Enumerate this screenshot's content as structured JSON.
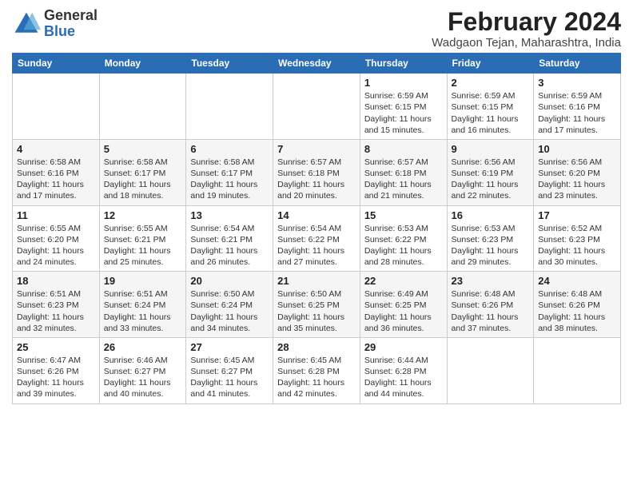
{
  "logo": {
    "general": "General",
    "blue": "Blue"
  },
  "header": {
    "month_year": "February 2024",
    "location": "Wadgaon Tejan, Maharashtra, India"
  },
  "weekdays": [
    "Sunday",
    "Monday",
    "Tuesday",
    "Wednesday",
    "Thursday",
    "Friday",
    "Saturday"
  ],
  "weeks": [
    [
      {
        "day": "",
        "info": ""
      },
      {
        "day": "",
        "info": ""
      },
      {
        "day": "",
        "info": ""
      },
      {
        "day": "",
        "info": ""
      },
      {
        "day": "1",
        "info": "Sunrise: 6:59 AM\nSunset: 6:15 PM\nDaylight: 11 hours\nand 15 minutes."
      },
      {
        "day": "2",
        "info": "Sunrise: 6:59 AM\nSunset: 6:15 PM\nDaylight: 11 hours\nand 16 minutes."
      },
      {
        "day": "3",
        "info": "Sunrise: 6:59 AM\nSunset: 6:16 PM\nDaylight: 11 hours\nand 17 minutes."
      }
    ],
    [
      {
        "day": "4",
        "info": "Sunrise: 6:58 AM\nSunset: 6:16 PM\nDaylight: 11 hours\nand 17 minutes."
      },
      {
        "day": "5",
        "info": "Sunrise: 6:58 AM\nSunset: 6:17 PM\nDaylight: 11 hours\nand 18 minutes."
      },
      {
        "day": "6",
        "info": "Sunrise: 6:58 AM\nSunset: 6:17 PM\nDaylight: 11 hours\nand 19 minutes."
      },
      {
        "day": "7",
        "info": "Sunrise: 6:57 AM\nSunset: 6:18 PM\nDaylight: 11 hours\nand 20 minutes."
      },
      {
        "day": "8",
        "info": "Sunrise: 6:57 AM\nSunset: 6:18 PM\nDaylight: 11 hours\nand 21 minutes."
      },
      {
        "day": "9",
        "info": "Sunrise: 6:56 AM\nSunset: 6:19 PM\nDaylight: 11 hours\nand 22 minutes."
      },
      {
        "day": "10",
        "info": "Sunrise: 6:56 AM\nSunset: 6:20 PM\nDaylight: 11 hours\nand 23 minutes."
      }
    ],
    [
      {
        "day": "11",
        "info": "Sunrise: 6:55 AM\nSunset: 6:20 PM\nDaylight: 11 hours\nand 24 minutes."
      },
      {
        "day": "12",
        "info": "Sunrise: 6:55 AM\nSunset: 6:21 PM\nDaylight: 11 hours\nand 25 minutes."
      },
      {
        "day": "13",
        "info": "Sunrise: 6:54 AM\nSunset: 6:21 PM\nDaylight: 11 hours\nand 26 minutes."
      },
      {
        "day": "14",
        "info": "Sunrise: 6:54 AM\nSunset: 6:22 PM\nDaylight: 11 hours\nand 27 minutes."
      },
      {
        "day": "15",
        "info": "Sunrise: 6:53 AM\nSunset: 6:22 PM\nDaylight: 11 hours\nand 28 minutes."
      },
      {
        "day": "16",
        "info": "Sunrise: 6:53 AM\nSunset: 6:23 PM\nDaylight: 11 hours\nand 29 minutes."
      },
      {
        "day": "17",
        "info": "Sunrise: 6:52 AM\nSunset: 6:23 PM\nDaylight: 11 hours\nand 30 minutes."
      }
    ],
    [
      {
        "day": "18",
        "info": "Sunrise: 6:51 AM\nSunset: 6:23 PM\nDaylight: 11 hours\nand 32 minutes."
      },
      {
        "day": "19",
        "info": "Sunrise: 6:51 AM\nSunset: 6:24 PM\nDaylight: 11 hours\nand 33 minutes."
      },
      {
        "day": "20",
        "info": "Sunrise: 6:50 AM\nSunset: 6:24 PM\nDaylight: 11 hours\nand 34 minutes."
      },
      {
        "day": "21",
        "info": "Sunrise: 6:50 AM\nSunset: 6:25 PM\nDaylight: 11 hours\nand 35 minutes."
      },
      {
        "day": "22",
        "info": "Sunrise: 6:49 AM\nSunset: 6:25 PM\nDaylight: 11 hours\nand 36 minutes."
      },
      {
        "day": "23",
        "info": "Sunrise: 6:48 AM\nSunset: 6:26 PM\nDaylight: 11 hours\nand 37 minutes."
      },
      {
        "day": "24",
        "info": "Sunrise: 6:48 AM\nSunset: 6:26 PM\nDaylight: 11 hours\nand 38 minutes."
      }
    ],
    [
      {
        "day": "25",
        "info": "Sunrise: 6:47 AM\nSunset: 6:26 PM\nDaylight: 11 hours\nand 39 minutes."
      },
      {
        "day": "26",
        "info": "Sunrise: 6:46 AM\nSunset: 6:27 PM\nDaylight: 11 hours\nand 40 minutes."
      },
      {
        "day": "27",
        "info": "Sunrise: 6:45 AM\nSunset: 6:27 PM\nDaylight: 11 hours\nand 41 minutes."
      },
      {
        "day": "28",
        "info": "Sunrise: 6:45 AM\nSunset: 6:28 PM\nDaylight: 11 hours\nand 42 minutes."
      },
      {
        "day": "29",
        "info": "Sunrise: 6:44 AM\nSunset: 6:28 PM\nDaylight: 11 hours\nand 44 minutes."
      },
      {
        "day": "",
        "info": ""
      },
      {
        "day": "",
        "info": ""
      }
    ]
  ]
}
